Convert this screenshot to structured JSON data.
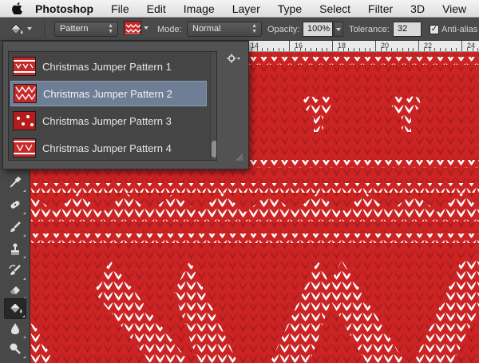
{
  "menubar": {
    "app_name": "Photoshop",
    "items": [
      "File",
      "Edit",
      "Image",
      "Layer",
      "Type",
      "Select",
      "Filter",
      "3D",
      "View"
    ]
  },
  "options": {
    "fill_source": "Pattern",
    "mode_label": "Mode:",
    "mode_value": "Normal",
    "opacity_label": "Opacity:",
    "opacity_value": "100%",
    "tolerance_label": "Tolerance:",
    "tolerance_value": "32",
    "anti_alias_label": "Anti-alias",
    "anti_alias_checked": true
  },
  "ruler": {
    "labels": [
      "14",
      "16",
      "18",
      "20",
      "22",
      "24"
    ]
  },
  "pattern_picker": {
    "selected_index": 1,
    "patterns": [
      {
        "label": "Christmas Jumper Pattern 1"
      },
      {
        "label": "Christmas Jumper Pattern 2"
      },
      {
        "label": "Christmas Jumper Pattern 3"
      },
      {
        "label": "Christmas Jumper Pattern 4"
      }
    ]
  },
  "toolbar": {
    "tools": [
      "eyedropper-tool",
      "spot-healing-brush-tool",
      "brush-tool",
      "clone-stamp-tool",
      "history-brush-tool",
      "eraser-tool",
      "paint-bucket-tool",
      "blur-tool",
      "dodge-tool"
    ],
    "active_tool": "paint-bucket-tool"
  },
  "colors": {
    "knit_red": "#cc2424",
    "knit_white": "#ffffff",
    "selection_blue": "#6e7e95"
  }
}
